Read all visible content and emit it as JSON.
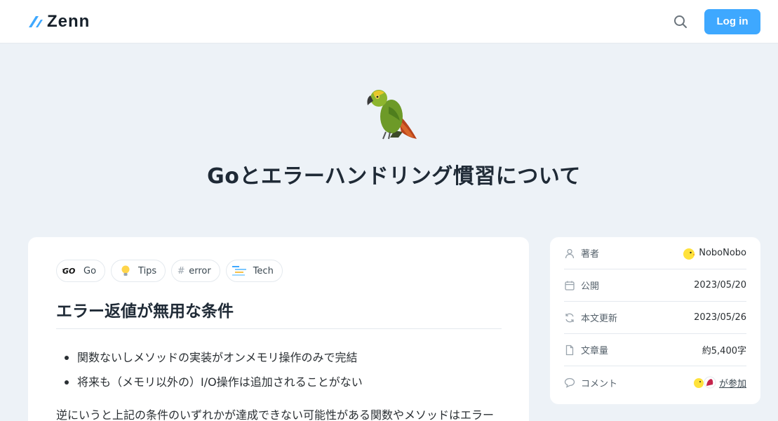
{
  "header": {
    "logo_text": "Zenn",
    "login_label": "Log in",
    "accent_color": "#3ea8ff"
  },
  "article": {
    "emoji": "parrot",
    "title": "Goとエラーハンドリング慣習について",
    "topics": [
      {
        "label": "Go",
        "icon": "go-logo-icon"
      },
      {
        "label": "Tips",
        "icon": "lightbulb-icon"
      },
      {
        "label": "error",
        "icon": "hash-icon"
      },
      {
        "label": "Tech",
        "icon": "tech-icon"
      }
    ],
    "heading": "エラー返値が無用な条件",
    "bullets": [
      "関数ないしメソッドの実装がオンメモリ操作のみで完結",
      "将来も（メモリ以外の）I/O操作は追加されることがない"
    ],
    "paragraph": "逆にいうと上記の条件のいずれかが達成できない可能性がある関数やメソッドはエラー"
  },
  "sidebar": {
    "author_label": "著者",
    "author_name": "NoboNobo",
    "published_label": "公開",
    "published_date": "2023/05/20",
    "updated_label": "本文更新",
    "updated_date": "2023/05/26",
    "length_label": "文章量",
    "length_value": "約5,400字",
    "comments_label": "コメント",
    "comments_link": "が参加"
  }
}
